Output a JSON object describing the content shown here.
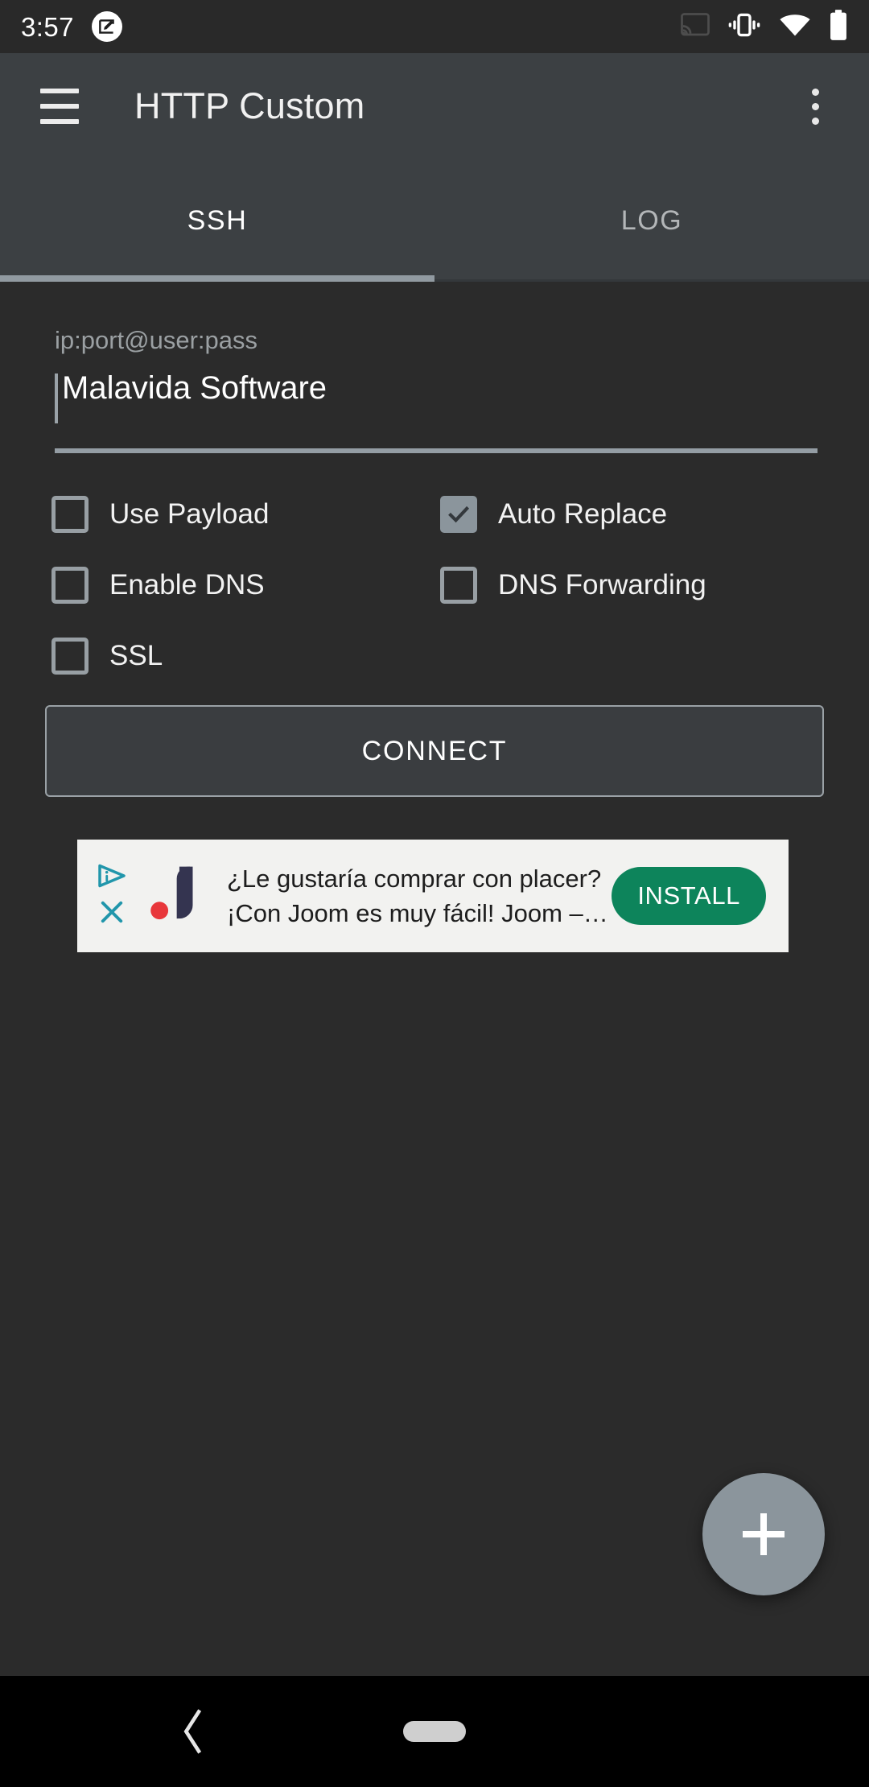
{
  "status_bar": {
    "clock": "3:57",
    "icons": [
      "screenshot-edit-icon",
      "cast-icon",
      "vibrate-icon",
      "wifi-icon",
      "battery-icon"
    ],
    "background": "#292929"
  },
  "app_bar": {
    "title": "HTTP Custom",
    "menu_icon": "hamburger-menu-icon",
    "overflow_icon": "overflow-menu-icon",
    "background": "#3c4043"
  },
  "tabs": [
    {
      "label": "SSH",
      "active": true
    },
    {
      "label": "LOG",
      "active": false
    }
  ],
  "tab_indicator_color": "#919aa1",
  "form": {
    "field_label": "ip:port@user:pass",
    "field_value": "Malavida Software",
    "checkboxes": [
      {
        "label": "Use Payload",
        "checked": false
      },
      {
        "label": "Auto Replace",
        "checked": true
      },
      {
        "label": "Enable DNS",
        "checked": false
      },
      {
        "label": "DNS Forwarding",
        "checked": false
      },
      {
        "label": "SSL",
        "checked": false
      }
    ],
    "connect_label": "CONNECT"
  },
  "ad": {
    "adchoices_icon": "adchoices-icon",
    "close_icon": "close-icon",
    "brand_icon": "joom-logo-icon",
    "line1": "¿Le gustaría comprar con placer?",
    "line2": "¡Con Joom es muy fácil! Joom –…",
    "install_label": "INSTALL",
    "install_color": "#0d845b",
    "background": "#f2f2f0"
  },
  "fab": {
    "icon": "plus-icon",
    "color": "#8b959c"
  },
  "nav_bar": {
    "back_icon": "back-chevron-icon",
    "home_icon": "home-pill-icon",
    "background": "#000000"
  },
  "colors": {
    "page_background": "#2b2b2b",
    "app_bar": "#3c4043",
    "accent_gray": "#8b959c",
    "text_primary": "#ffffff",
    "text_secondary": "#9ba0a3"
  }
}
